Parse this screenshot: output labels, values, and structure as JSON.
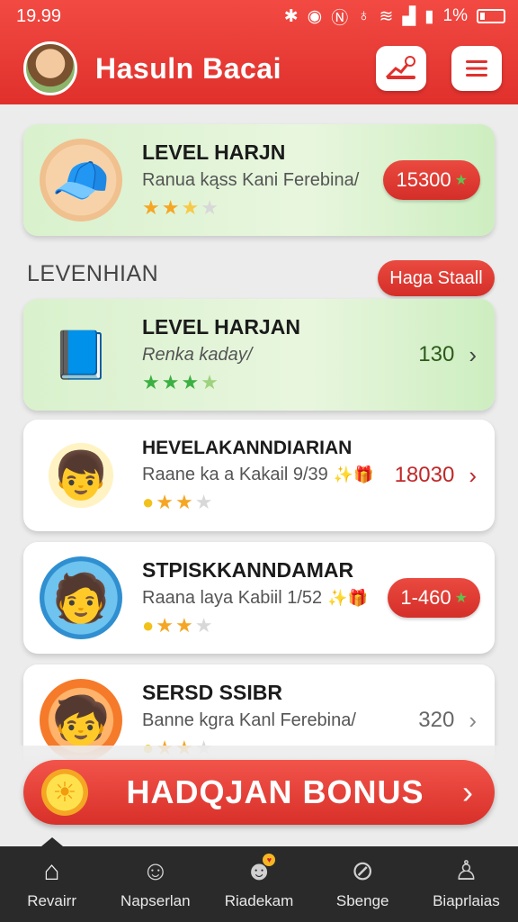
{
  "status_bar": {
    "time": "19.99",
    "battery": "1%"
  },
  "header": {
    "title": "Hasuln Bacai"
  },
  "featured": {
    "title": "LEVEL HARJN",
    "subtitle": "Ranua kąss Kani Ferebina/",
    "stars": 3,
    "badge_value": "15300"
  },
  "section": {
    "title": "LEVENHIAN",
    "button_label": "Haga Staall"
  },
  "items": [
    {
      "title": "LEVEL HARJAN",
      "subtitle": "Renka kaday/",
      "stars": 3,
      "value": "130"
    },
    {
      "title": "HEVELAKANNDIARIAN",
      "subtitle": "Raane ka a Kakail 9/39",
      "stars": 3,
      "value": "18030"
    },
    {
      "title": "STPISKKANNDAMAR",
      "subtitle": "Raana laya Kabiil 1/52",
      "stars": 3,
      "value": "1-460"
    },
    {
      "title": "SERSD SSIBR",
      "subtitle": "Banne kgra Kanl Ferebina/",
      "stars": 3,
      "value": "320"
    }
  ],
  "bonus": {
    "label": "HADQJAN BONUS"
  },
  "nav": [
    {
      "label": "Revairr",
      "icon": "home-icon"
    },
    {
      "label": "Napserlan",
      "icon": "person-icon"
    },
    {
      "label": "Riadekam",
      "icon": "face-icon"
    },
    {
      "label": "Sbenge",
      "icon": "compass-icon"
    },
    {
      "label": "Biaprlaias",
      "icon": "figure-icon"
    }
  ],
  "colors": {
    "accent": "#e0302c",
    "nav_bg": "#2a2a2a",
    "card_green": "#d9f1cd"
  }
}
